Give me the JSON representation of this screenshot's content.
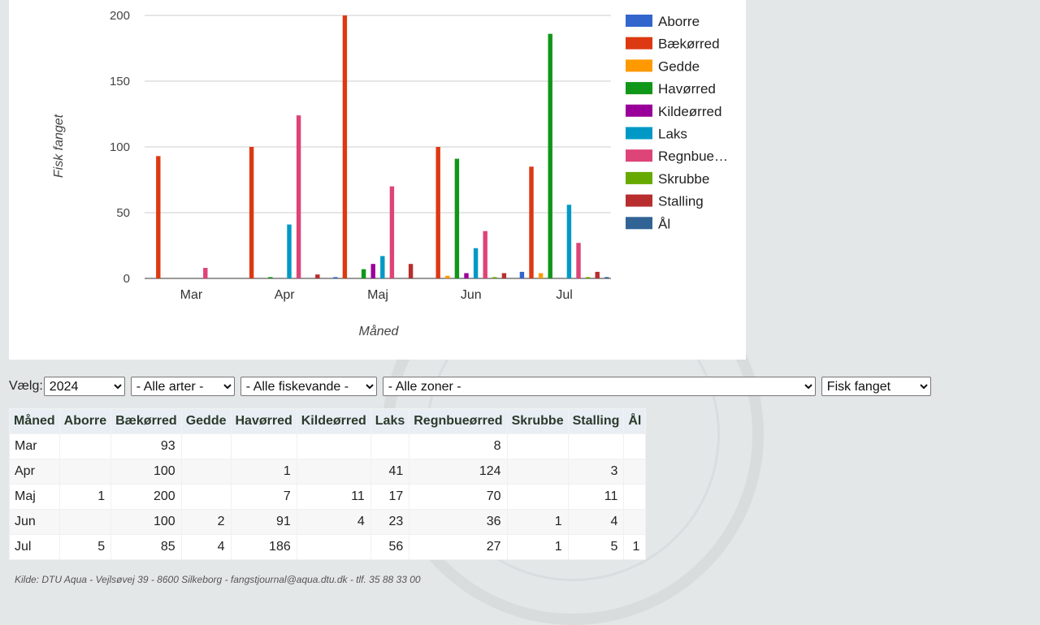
{
  "chart_data": {
    "type": "bar",
    "xlabel": "Måned",
    "ylabel": "Fisk fanget",
    "ylim": [
      0,
      200
    ],
    "yticks": [
      0,
      50,
      100,
      150,
      200
    ],
    "categories": [
      "Mar",
      "Apr",
      "Maj",
      "Jun",
      "Jul"
    ],
    "legend_position": "right",
    "grid": true,
    "series": [
      {
        "name": "Aborre",
        "color": "#3366cc",
        "values": [
          0,
          0,
          1,
          0,
          5
        ]
      },
      {
        "name": "Bækørred",
        "color": "#dc3912",
        "values": [
          93,
          100,
          200,
          100,
          85
        ]
      },
      {
        "name": "Gedde",
        "color": "#ff9900",
        "values": [
          0,
          0,
          0,
          2,
          4
        ]
      },
      {
        "name": "Havørred",
        "color": "#109618",
        "values": [
          0,
          1,
          7,
          91,
          186
        ]
      },
      {
        "name": "Kildeørred",
        "color": "#990099",
        "values": [
          0,
          0,
          11,
          4,
          0
        ]
      },
      {
        "name": "Laks",
        "color": "#0099c6",
        "values": [
          0,
          41,
          17,
          23,
          56
        ]
      },
      {
        "name": "Regnbue…",
        "color": "#dd4477",
        "values": [
          8,
          124,
          70,
          36,
          27
        ]
      },
      {
        "name": "Skrubbe",
        "color": "#66aa00",
        "values": [
          0,
          0,
          0,
          1,
          1
        ]
      },
      {
        "name": "Stalling",
        "color": "#b82e2e",
        "values": [
          0,
          3,
          11,
          4,
          5
        ]
      },
      {
        "name": "Ål",
        "color": "#316395",
        "values": [
          0,
          0,
          0,
          0,
          1
        ]
      }
    ]
  },
  "controls": {
    "label": "Vælg:",
    "year": "2024",
    "species": "- Alle arter -",
    "waters": "- Alle fiskevande -",
    "zones": "- Alle zoner -",
    "metric": "Fisk fanget"
  },
  "table": {
    "headers": [
      "Måned",
      "Aborre",
      "Bækørred",
      "Gedde",
      "Havørred",
      "Kildeørred",
      "Laks",
      "Regnbueørred",
      "Skrubbe",
      "Stalling",
      "Ål"
    ],
    "rows": [
      [
        "Mar",
        "",
        "93",
        "",
        "",
        "",
        "",
        "8",
        "",
        "",
        ""
      ],
      [
        "Apr",
        "",
        "100",
        "",
        "1",
        "",
        "41",
        "124",
        "",
        "3",
        ""
      ],
      [
        "Maj",
        "1",
        "200",
        "",
        "7",
        "11",
        "17",
        "70",
        "",
        "11",
        ""
      ],
      [
        "Jun",
        "",
        "100",
        "2",
        "91",
        "4",
        "23",
        "36",
        "1",
        "4",
        ""
      ],
      [
        "Jul",
        "5",
        "85",
        "4",
        "186",
        "",
        "56",
        "27",
        "1",
        "5",
        "1"
      ]
    ]
  },
  "footer": {
    "text": "Kilde: DTU Aqua - Vejlsøvej 39 - 8600 Silkeborg - fangstjournal@aqua.dtu.dk - tlf. 35 88 33 00"
  }
}
